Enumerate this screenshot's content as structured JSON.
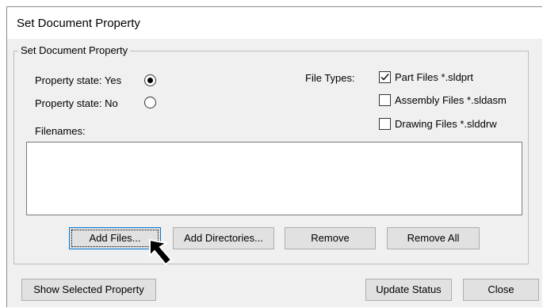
{
  "window": {
    "title": "Set Document Property"
  },
  "group": {
    "legend": "Set Document Property",
    "property_state_yes_label": "Property state: Yes",
    "property_state_no_label": "Property state: No",
    "property_state_selected": "yes",
    "file_types_label": "File Types:",
    "file_types": [
      {
        "label": "Part Files *.sldprt",
        "checked": true
      },
      {
        "label": "Assembly Files *.sldasm",
        "checked": false
      },
      {
        "label": "Drawing Files *.slddrw",
        "checked": false
      }
    ],
    "filenames_label": "Filenames:",
    "filenames": []
  },
  "buttons": {
    "add_files": "Add Files...",
    "add_directories": "Add Directories...",
    "remove": "Remove",
    "remove_all": "Remove All",
    "show_selected_property": "Show Selected Property",
    "update_status": "Update Status",
    "close": "Close"
  },
  "cursor": {
    "icon": "arrow-cursor-icon"
  }
}
